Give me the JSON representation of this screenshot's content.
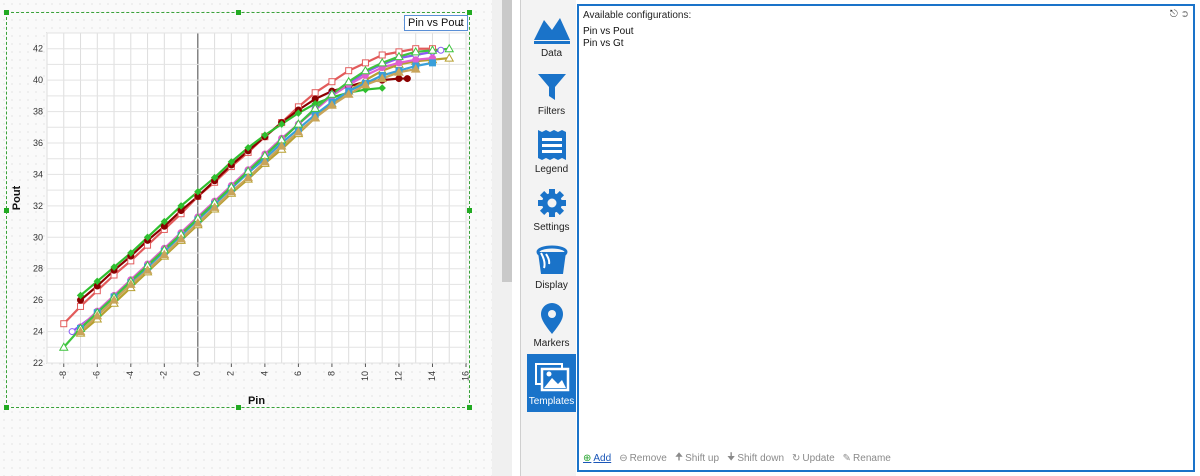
{
  "chart_selector": {
    "selected": "Pin vs Pout"
  },
  "chart_data": {
    "type": "line",
    "xlabel": "Pin",
    "ylabel": "Pout",
    "xlim": [
      -9,
      16
    ],
    "ylim": [
      22,
      43
    ],
    "x_ticks": [
      "-8",
      "-6",
      "-4",
      "-2",
      "0",
      "2",
      "4",
      "6",
      "8",
      "10",
      "12",
      "14",
      "16"
    ],
    "y_ticks": [
      "22",
      "24",
      "26",
      "28",
      "30",
      "32",
      "34",
      "36",
      "38",
      "40",
      "42"
    ],
    "grid": true,
    "series": [
      {
        "color": "#e25b5b",
        "marker": "open-square",
        "x": [
          -8,
          -7,
          -6,
          -5,
          -4,
          -3,
          -2,
          -1,
          0,
          1,
          2,
          3,
          4,
          5,
          6,
          7,
          8,
          9,
          10,
          11,
          12,
          13,
          14
        ],
        "y": [
          24.5,
          25.6,
          26.6,
          27.6,
          28.5,
          29.5,
          30.5,
          31.5,
          32.6,
          33.5,
          34.5,
          35.4,
          36.4,
          37.3,
          38.3,
          39.2,
          39.9,
          40.6,
          41.1,
          41.6,
          41.8,
          42.0,
          42.0
        ]
      },
      {
        "color": "#8b0000",
        "marker": "filled-circle",
        "x": [
          -7,
          -6,
          -5,
          -4,
          -3,
          -2,
          -1,
          0,
          1,
          2,
          3,
          4,
          5,
          6,
          7,
          8,
          9,
          10,
          11,
          12,
          12.5
        ],
        "y": [
          26.0,
          26.9,
          27.9,
          28.8,
          29.8,
          30.7,
          31.7,
          32.6,
          33.6,
          34.6,
          35.5,
          36.4,
          37.3,
          38.1,
          38.8,
          39.3,
          39.6,
          39.9,
          40.0,
          40.1,
          40.1
        ]
      },
      {
        "color": "#2fbf2f",
        "marker": "filled-diamond",
        "x": [
          -7,
          -6,
          -5,
          -4,
          -3,
          -2,
          -1,
          0,
          1,
          2,
          3,
          4,
          5,
          6,
          7,
          8,
          9,
          10,
          11
        ],
        "y": [
          26.3,
          27.2,
          28.1,
          29.0,
          30.0,
          31.0,
          32.0,
          32.9,
          33.8,
          34.8,
          35.7,
          36.5,
          37.2,
          37.9,
          38.5,
          38.9,
          39.2,
          39.4,
          39.5
        ]
      },
      {
        "color": "#b8a030",
        "marker": "open-triangle",
        "x": [
          -7,
          -6,
          -5,
          -4,
          -3,
          -2,
          -1,
          0,
          1,
          2,
          3,
          4,
          5,
          6,
          7,
          8,
          9,
          10,
          11,
          12,
          13,
          14,
          15
        ],
        "y": [
          23.9,
          24.8,
          25.8,
          26.8,
          27.8,
          28.8,
          29.8,
          30.8,
          31.8,
          32.8,
          33.7,
          34.7,
          35.6,
          36.6,
          37.6,
          38.5,
          39.3,
          40.0,
          40.6,
          41.0,
          41.2,
          41.3,
          41.4
        ]
      },
      {
        "color": "#8a5cf5",
        "marker": "open-circle",
        "x": [
          -7.5,
          -6,
          -5,
          -4,
          -3,
          -2,
          -1,
          0,
          1,
          2,
          3,
          4,
          5,
          6,
          7,
          8,
          9,
          10,
          11,
          12,
          13,
          14,
          14.5
        ],
        "y": [
          24.0,
          25.2,
          26.2,
          27.2,
          28.2,
          29.2,
          30.2,
          31.2,
          32.2,
          33.2,
          34.2,
          35.2,
          36.2,
          37.2,
          38.2,
          39.1,
          39.8,
          40.5,
          41.0,
          41.4,
          41.6,
          41.8,
          41.9
        ]
      },
      {
        "color": "#e060d0",
        "marker": "filled-circle",
        "x": [
          -7,
          -6,
          -5,
          -4,
          -3,
          -2,
          -1,
          0,
          1,
          2,
          3,
          4,
          5,
          6,
          7,
          8,
          9,
          10,
          11,
          12,
          13,
          14
        ],
        "y": [
          24.3,
          25.3,
          26.3,
          27.3,
          28.3,
          29.3,
          30.3,
          31.3,
          32.3,
          33.3,
          34.3,
          35.3,
          36.3,
          37.2,
          38.1,
          39.0,
          39.7,
          40.3,
          40.8,
          41.1,
          41.3,
          41.4
        ]
      },
      {
        "color": "#3a9fd9",
        "marker": "filled-square",
        "x": [
          -7,
          -6,
          -5,
          -4,
          -3,
          -2,
          -1,
          0,
          1,
          2,
          3,
          4,
          5,
          6,
          7,
          8,
          9,
          10,
          11,
          12,
          13,
          14
        ],
        "y": [
          24.2,
          25.2,
          26.2,
          27.1,
          28.1,
          29.1,
          30.1,
          31.1,
          32.1,
          33.1,
          34.1,
          35.0,
          36.0,
          36.9,
          37.8,
          38.6,
          39.3,
          39.8,
          40.3,
          40.6,
          40.9,
          41.1
        ]
      },
      {
        "color": "#3ec43e",
        "marker": "open-triangle",
        "x": [
          -8,
          -7,
          -6,
          -5,
          -4,
          -3,
          -2,
          -1,
          0,
          1,
          2,
          3,
          4,
          5,
          6,
          7,
          8,
          9,
          10,
          11,
          12,
          13,
          14,
          15
        ],
        "y": [
          23.0,
          24.2,
          25.2,
          26.2,
          27.2,
          28.2,
          29.2,
          30.2,
          31.2,
          32.2,
          33.2,
          34.2,
          35.2,
          36.2,
          37.2,
          38.2,
          39.1,
          39.9,
          40.6,
          41.1,
          41.5,
          41.8,
          41.9,
          42.0
        ]
      },
      {
        "color": "#c8a45a",
        "marker": "filled-triangle",
        "x": [
          -7,
          -6,
          -5,
          -4,
          -3,
          -2,
          -1,
          0,
          1,
          2,
          3,
          4,
          5,
          6,
          7,
          8,
          9,
          10,
          11,
          12,
          13
        ],
        "y": [
          24.0,
          25.0,
          26.0,
          27.0,
          27.9,
          28.9,
          29.9,
          30.9,
          31.9,
          32.9,
          33.8,
          34.8,
          35.8,
          36.7,
          37.6,
          38.4,
          39.1,
          39.7,
          40.1,
          40.5,
          40.7
        ]
      }
    ]
  },
  "nav": {
    "items": [
      {
        "label": "Data",
        "icon": "mountains-icon"
      },
      {
        "label": "Filters",
        "icon": "funnel-icon"
      },
      {
        "label": "Legend",
        "icon": "list-icon"
      },
      {
        "label": "Settings",
        "icon": "gear-icon"
      },
      {
        "label": "Display",
        "icon": "paint-bucket-icon"
      },
      {
        "label": "Markers",
        "icon": "map-pin-icon"
      },
      {
        "label": "Templates",
        "icon": "images-icon"
      }
    ],
    "active": "Templates"
  },
  "templates": {
    "header": "Available configurations:",
    "items": [
      "Pin vs Pout",
      "Pin vs Gt"
    ],
    "toolbar": {
      "add": "Add",
      "remove": "Remove",
      "shift_up": "Shift up",
      "shift_down": "Shift down",
      "update": "Update",
      "rename": "Rename"
    }
  },
  "colors": {
    "accent": "#1a73c9",
    "selection": "#22aa22"
  }
}
